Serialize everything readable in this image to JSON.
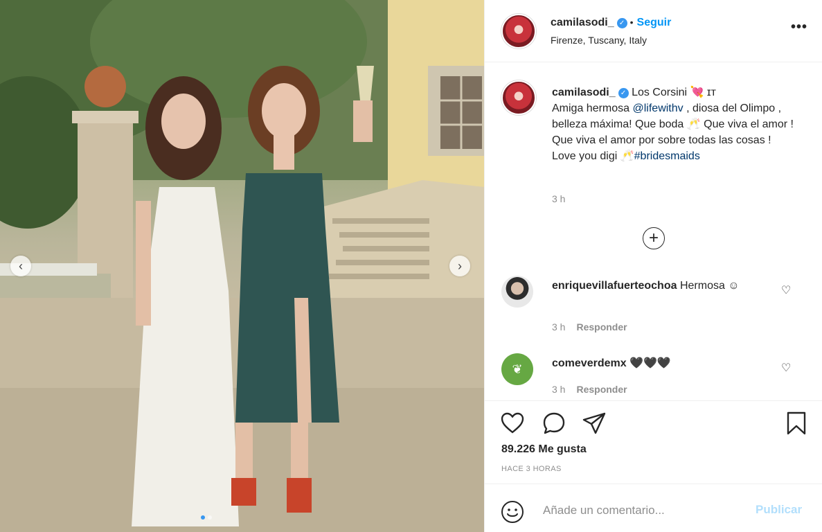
{
  "post": {
    "username": "camilasodi_",
    "separator": "•",
    "follow_label": "Seguir",
    "location": "Firenze, Tuscany, Italy",
    "more_icon": "more-horizontal-icon",
    "more_label": "•••"
  },
  "caption": {
    "username": "camilasodi_",
    "text_part1": "Los Corsini 💘 ɪᴛ",
    "text_part2": "Amiga hermosa ",
    "mention": "@lifewithv",
    "text_part3": " , diosa del Olimpo , belleza máxima! Que boda 🥂 Que viva el amor ! Que viva el amor por sobre todas las cosas ! Love you digi 🥂",
    "hashtag": "#bridesmaids",
    "time": "3 h"
  },
  "load_more_label": "+",
  "comments": [
    {
      "username": "enriquevillafuerteochoa",
      "text": "Hermosa ☺",
      "time": "3 h",
      "reply_label": "Responder"
    },
    {
      "username": "comeverdemx",
      "text": "🖤🖤🖤",
      "time": "3 h",
      "reply_label": "Responder"
    }
  ],
  "actions": {
    "likes": "89.226 Me gusta",
    "posted": "HACE 3 HORAS"
  },
  "add_comment": {
    "placeholder": "Añade un comentario...",
    "publish_label": "Publicar"
  },
  "carousel": {
    "prev": "‹",
    "next": "›"
  },
  "colors": {
    "accent": "#0095f6",
    "publish_disabled": "#b2dffc",
    "text": "#262626",
    "muted": "#8e8e8e"
  }
}
